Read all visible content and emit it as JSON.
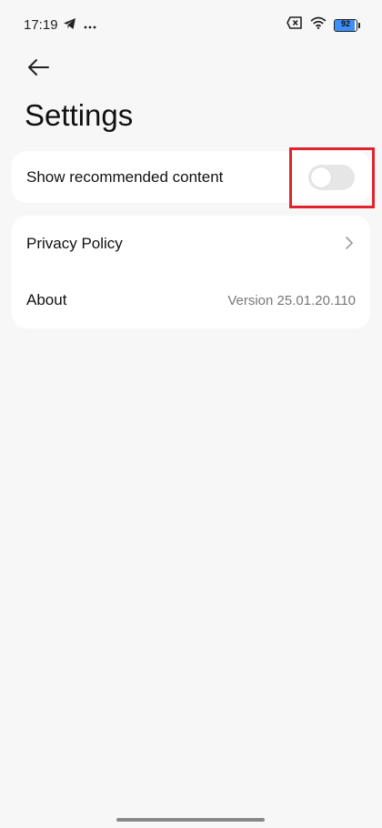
{
  "status_bar": {
    "time": "17:19",
    "left_icons": [
      "telegram-icon",
      "more-dots-icon"
    ],
    "right_icons": [
      "sim-off-icon",
      "wifi-icon",
      "battery-icon"
    ],
    "battery_level": "92"
  },
  "header": {
    "back_icon": "arrow-left-icon",
    "title": "Settings"
  },
  "settings": {
    "recommended": {
      "label": "Show recommended content",
      "enabled": false
    },
    "privacy": {
      "label": "Privacy Policy",
      "icon": "chevron-right-icon"
    },
    "about": {
      "label": "About",
      "value": "Version 25.01.20.110"
    }
  },
  "colors": {
    "background": "#f7f7f7",
    "card": "#ffffff",
    "toggle_off": "#e6e6e6",
    "highlight": "#e0232c",
    "battery_fill": "#3e8ef7"
  }
}
